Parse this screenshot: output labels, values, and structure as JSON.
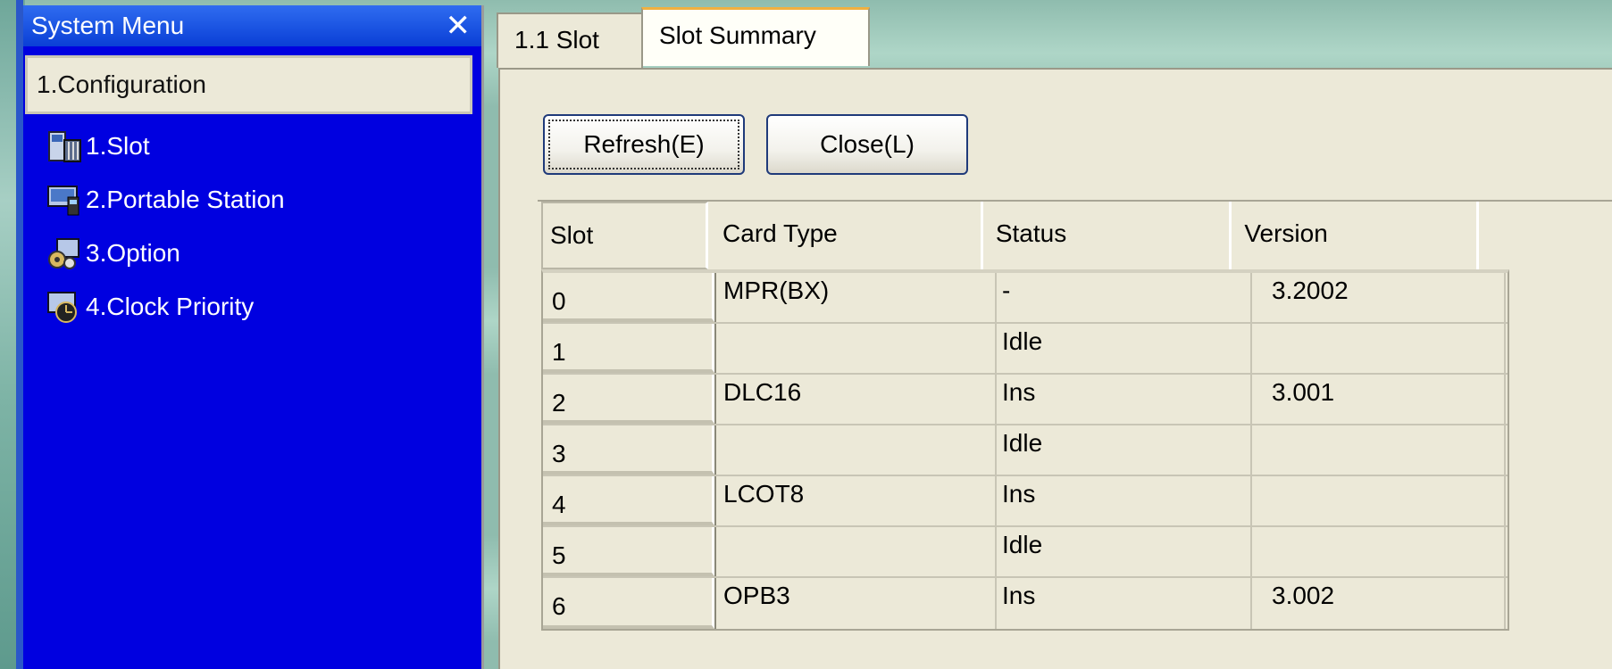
{
  "system_menu": {
    "title": "System Menu",
    "close_glyph": "✕",
    "section": "1.Configuration",
    "items": [
      {
        "label": "1.Slot",
        "icon": "slot-rack-icon"
      },
      {
        "label": "2.Portable Station",
        "icon": "portable-station-icon"
      },
      {
        "label": "3.Option",
        "icon": "option-gears-icon"
      },
      {
        "label": "4.Clock Priority",
        "icon": "clock-priority-icon"
      }
    ]
  },
  "tabs": [
    {
      "label": "1.1 Slot",
      "active": false
    },
    {
      "label": "Slot Summary",
      "active": true
    }
  ],
  "buttons": {
    "refresh": "Refresh(E)",
    "close": "Close(L)"
  },
  "table": {
    "columns": [
      "Slot",
      "Card Type",
      "Status",
      "Version"
    ],
    "rows": [
      {
        "slot": "0",
        "card_type": "MPR(BX)",
        "status": "-",
        "version": "3.2002"
      },
      {
        "slot": "1",
        "card_type": "",
        "status": "Idle",
        "version": ""
      },
      {
        "slot": "2",
        "card_type": "DLC16",
        "status": "Ins",
        "version": "3.001"
      },
      {
        "slot": "3",
        "card_type": "",
        "status": "Idle",
        "version": ""
      },
      {
        "slot": "4",
        "card_type": "LCOT8",
        "status": "Ins",
        "version": ""
      },
      {
        "slot": "5",
        "card_type": "",
        "status": "Idle",
        "version": ""
      },
      {
        "slot": "6",
        "card_type": "OPB3",
        "status": "Ins",
        "version": "3.002"
      }
    ]
  },
  "colors": {
    "menu_bg": "#0000e0",
    "title_bar": "#0a3fd6",
    "panel_bg": "#ece9d8",
    "desktop": "#8fbcae"
  }
}
